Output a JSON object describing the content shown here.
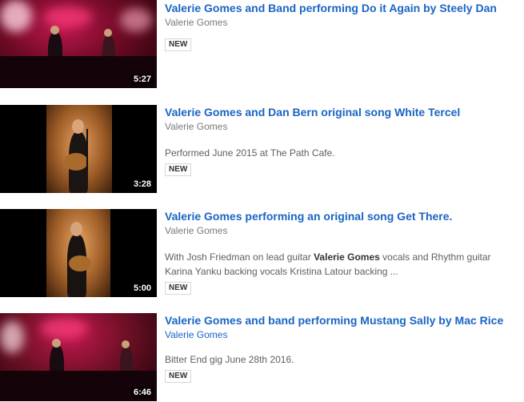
{
  "results": [
    {
      "title": "Valerie Gomes and Band performing Do it Again by Steely Dan",
      "channel": "Valerie Gomes",
      "description": "",
      "badge": "NEW",
      "duration": "5:27"
    },
    {
      "title": "Valerie Gomes and Dan Bern original song White Tercel",
      "channel": "Valerie Gomes",
      "description": "Performed June 2015 at The Path Cafe.",
      "badge": "NEW",
      "duration": "3:28"
    },
    {
      "title": "Valerie Gomes performing an original song Get There.",
      "channel": "Valerie Gomes",
      "description_before": "With Josh Friedman on lead guitar ",
      "description_bold": "Valerie Gomes",
      "description_after": " vocals and Rhythm guitar Karina Yanku backing vocals Kristina Latour backing ...",
      "badge": "NEW",
      "duration": "5:00"
    },
    {
      "title": "Valerie Gomes and band performing Mustang Sally by Mac Rice",
      "channel": "Valerie Gomes",
      "description": "Bitter End gig June 28th 2016.",
      "badge": "NEW",
      "duration": "6:46"
    }
  ],
  "colors": {
    "title_link": "#1a64c4",
    "channel_text": "#7a7a7a",
    "description_text": "#5f5f5f"
  }
}
